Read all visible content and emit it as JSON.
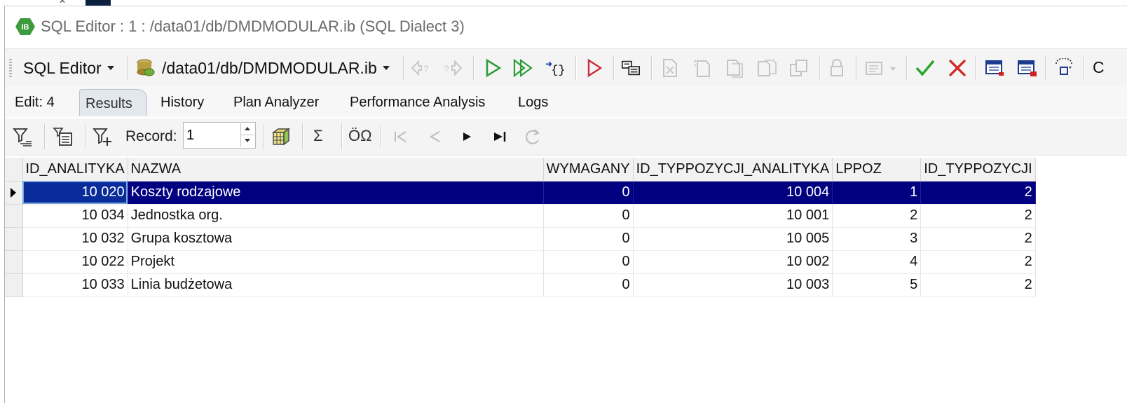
{
  "window": {
    "title": "SQL Editor : 1 : /data01/db/DMDMODULAR.ib (SQL Dialect 3)",
    "logo_text": "IB"
  },
  "toolbar": {
    "sql_editor_label": "SQL Editor",
    "database_label": "/data01/db/DMDMODULAR.ib",
    "clipped_item": "C",
    "icons": [
      "prev-query-icon",
      "next-query-icon",
      "execute-icon",
      "execute-script-icon",
      "execute-batch-icon",
      "debug-icon",
      "plan-icon",
      "new-icon",
      "copy-icon",
      "paste-icon",
      "paste-alt-icon",
      "duplicate-icon",
      "lock-icon",
      "options-icon",
      "commit-icon",
      "rollback-icon",
      "calendar-icon",
      "calendar-add-icon",
      "select-region-icon"
    ]
  },
  "tabs": [
    {
      "label": "Edit: 4",
      "active": false
    },
    {
      "label": "Results",
      "active": true
    },
    {
      "label": "History",
      "active": false
    },
    {
      "label": "Plan Analyzer",
      "active": false
    },
    {
      "label": "Performance Analysis",
      "active": false
    },
    {
      "label": "Logs",
      "active": false
    }
  ],
  "gridbar": {
    "record_label": "Record:",
    "record_value": "1",
    "sum_symbol": "Σ",
    "charset_symbol": "ÖΩ"
  },
  "grid": {
    "columns": [
      "ID_ANALITYKA",
      "NAZWA",
      "WYMAGANY",
      "ID_TYPPOZYCJI_ANALITYKA",
      "LPPOZ",
      "ID_TYPPOZYCJI"
    ],
    "rows": [
      [
        "10 020",
        "Koszty rodzajowe",
        "0",
        "10 004",
        "1",
        "2"
      ],
      [
        "10 034",
        "Jednostka org.",
        "0",
        "10 001",
        "2",
        "2"
      ],
      [
        "10 032",
        "Grupa kosztowa",
        "0",
        "10 005",
        "3",
        "2"
      ],
      [
        "10 022",
        "Projekt",
        "0",
        "10 002",
        "4",
        "2"
      ],
      [
        "10 033",
        "Linia budżetowa",
        "0",
        "10 003",
        "5",
        "2"
      ]
    ],
    "selected_row": 0
  },
  "colors": {
    "selection": "#000080",
    "commit_green": "#2aa52a",
    "rollback_red": "#d42020",
    "execute_green": "#2e9b3a"
  }
}
